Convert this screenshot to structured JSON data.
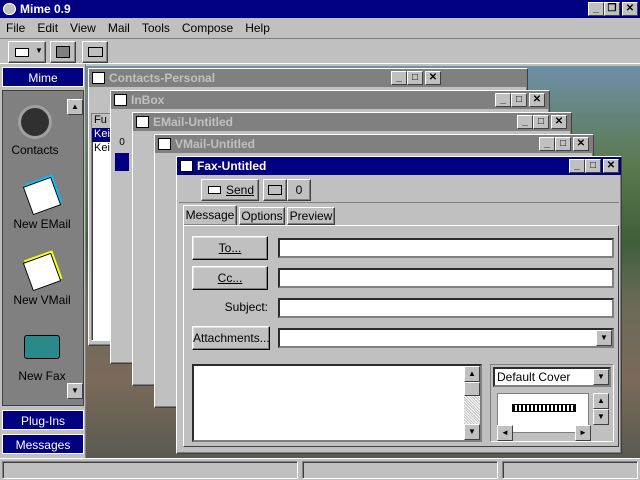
{
  "app": {
    "title": "Mime 0.9",
    "menu": [
      "File",
      "Edit",
      "View",
      "Mail",
      "Tools",
      "Compose",
      "Help"
    ]
  },
  "sidebar": {
    "header": "Mime",
    "items": [
      {
        "label": "Contacts",
        "icon": "rolodex-icon"
      },
      {
        "label": "New EMail",
        "icon": "email-envelope-icon"
      },
      {
        "label": "New VMail",
        "icon": "vmail-envelope-icon"
      },
      {
        "label": "New Fax",
        "icon": "fax-machine-icon"
      }
    ],
    "plugins": "Plug-Ins",
    "messages": "Messages"
  },
  "windows": {
    "contacts": {
      "title": "Contacts-Personal",
      "col_partial": "Fu",
      "rows": [
        "Kei",
        "Kei"
      ]
    },
    "inbox": {
      "title": "InBox"
    },
    "email": {
      "title": "EMail-Untitled"
    },
    "vmail": {
      "title": "VMail-Untitled"
    },
    "fax": {
      "title": "Fax-Untitled",
      "send_label": "Send",
      "tabs": [
        "Message",
        "Options",
        "Preview"
      ],
      "to_label": "To...",
      "cc_label": "Cc...",
      "subject_label": "Subject:",
      "attachments_label": "Attachments...",
      "to_value": "",
      "cc_value": "",
      "subject_value": "",
      "attachments_value": "",
      "cover_select": "Default Cover"
    }
  },
  "colors": {
    "desktop": "#c0c0c0",
    "title_active": "#000080",
    "title_inactive": "#808080"
  }
}
